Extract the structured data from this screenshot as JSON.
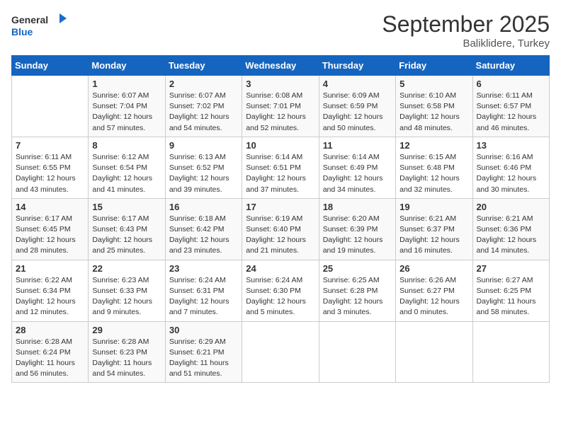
{
  "header": {
    "logo_general": "General",
    "logo_blue": "Blue",
    "month": "September 2025",
    "location": "Baliklidere, Turkey"
  },
  "days_of_week": [
    "Sunday",
    "Monday",
    "Tuesday",
    "Wednesday",
    "Thursday",
    "Friday",
    "Saturday"
  ],
  "weeks": [
    [
      {
        "day": "",
        "info": ""
      },
      {
        "day": "1",
        "info": "Sunrise: 6:07 AM\nSunset: 7:04 PM\nDaylight: 12 hours and 57 minutes."
      },
      {
        "day": "2",
        "info": "Sunrise: 6:07 AM\nSunset: 7:02 PM\nDaylight: 12 hours and 54 minutes."
      },
      {
        "day": "3",
        "info": "Sunrise: 6:08 AM\nSunset: 7:01 PM\nDaylight: 12 hours and 52 minutes."
      },
      {
        "day": "4",
        "info": "Sunrise: 6:09 AM\nSunset: 6:59 PM\nDaylight: 12 hours and 50 minutes."
      },
      {
        "day": "5",
        "info": "Sunrise: 6:10 AM\nSunset: 6:58 PM\nDaylight: 12 hours and 48 minutes."
      },
      {
        "day": "6",
        "info": "Sunrise: 6:11 AM\nSunset: 6:57 PM\nDaylight: 12 hours and 46 minutes."
      }
    ],
    [
      {
        "day": "7",
        "info": "Sunrise: 6:11 AM\nSunset: 6:55 PM\nDaylight: 12 hours and 43 minutes."
      },
      {
        "day": "8",
        "info": "Sunrise: 6:12 AM\nSunset: 6:54 PM\nDaylight: 12 hours and 41 minutes."
      },
      {
        "day": "9",
        "info": "Sunrise: 6:13 AM\nSunset: 6:52 PM\nDaylight: 12 hours and 39 minutes."
      },
      {
        "day": "10",
        "info": "Sunrise: 6:14 AM\nSunset: 6:51 PM\nDaylight: 12 hours and 37 minutes."
      },
      {
        "day": "11",
        "info": "Sunrise: 6:14 AM\nSunset: 6:49 PM\nDaylight: 12 hours and 34 minutes."
      },
      {
        "day": "12",
        "info": "Sunrise: 6:15 AM\nSunset: 6:48 PM\nDaylight: 12 hours and 32 minutes."
      },
      {
        "day": "13",
        "info": "Sunrise: 6:16 AM\nSunset: 6:46 PM\nDaylight: 12 hours and 30 minutes."
      }
    ],
    [
      {
        "day": "14",
        "info": "Sunrise: 6:17 AM\nSunset: 6:45 PM\nDaylight: 12 hours and 28 minutes."
      },
      {
        "day": "15",
        "info": "Sunrise: 6:17 AM\nSunset: 6:43 PM\nDaylight: 12 hours and 25 minutes."
      },
      {
        "day": "16",
        "info": "Sunrise: 6:18 AM\nSunset: 6:42 PM\nDaylight: 12 hours and 23 minutes."
      },
      {
        "day": "17",
        "info": "Sunrise: 6:19 AM\nSunset: 6:40 PM\nDaylight: 12 hours and 21 minutes."
      },
      {
        "day": "18",
        "info": "Sunrise: 6:20 AM\nSunset: 6:39 PM\nDaylight: 12 hours and 19 minutes."
      },
      {
        "day": "19",
        "info": "Sunrise: 6:21 AM\nSunset: 6:37 PM\nDaylight: 12 hours and 16 minutes."
      },
      {
        "day": "20",
        "info": "Sunrise: 6:21 AM\nSunset: 6:36 PM\nDaylight: 12 hours and 14 minutes."
      }
    ],
    [
      {
        "day": "21",
        "info": "Sunrise: 6:22 AM\nSunset: 6:34 PM\nDaylight: 12 hours and 12 minutes."
      },
      {
        "day": "22",
        "info": "Sunrise: 6:23 AM\nSunset: 6:33 PM\nDaylight: 12 hours and 9 minutes."
      },
      {
        "day": "23",
        "info": "Sunrise: 6:24 AM\nSunset: 6:31 PM\nDaylight: 12 hours and 7 minutes."
      },
      {
        "day": "24",
        "info": "Sunrise: 6:24 AM\nSunset: 6:30 PM\nDaylight: 12 hours and 5 minutes."
      },
      {
        "day": "25",
        "info": "Sunrise: 6:25 AM\nSunset: 6:28 PM\nDaylight: 12 hours and 3 minutes."
      },
      {
        "day": "26",
        "info": "Sunrise: 6:26 AM\nSunset: 6:27 PM\nDaylight: 12 hours and 0 minutes."
      },
      {
        "day": "27",
        "info": "Sunrise: 6:27 AM\nSunset: 6:25 PM\nDaylight: 11 hours and 58 minutes."
      }
    ],
    [
      {
        "day": "28",
        "info": "Sunrise: 6:28 AM\nSunset: 6:24 PM\nDaylight: 11 hours and 56 minutes."
      },
      {
        "day": "29",
        "info": "Sunrise: 6:28 AM\nSunset: 6:23 PM\nDaylight: 11 hours and 54 minutes."
      },
      {
        "day": "30",
        "info": "Sunrise: 6:29 AM\nSunset: 6:21 PM\nDaylight: 11 hours and 51 minutes."
      },
      {
        "day": "",
        "info": ""
      },
      {
        "day": "",
        "info": ""
      },
      {
        "day": "",
        "info": ""
      },
      {
        "day": "",
        "info": ""
      }
    ]
  ]
}
